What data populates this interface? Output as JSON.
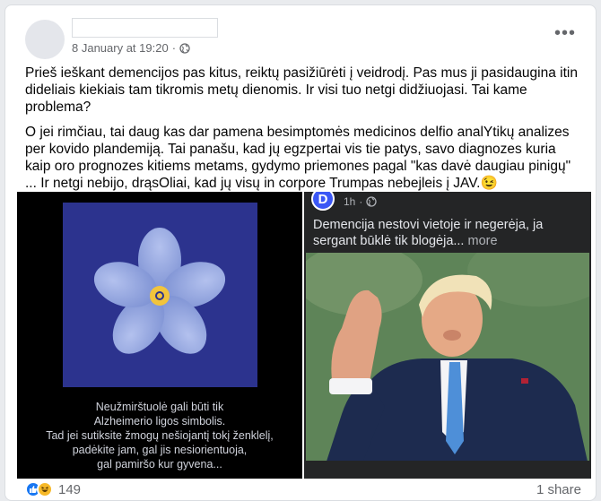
{
  "post": {
    "timestamp": "8 January at 19:20",
    "paragraph1": "Prieš ieškant demencijos pas kitus, reiktų pasižiūrėti į veidrodį. Pas mus ji pasidaugina itin dideliais kiekiais tam tikromis metų dienomis. Ir visi tuo netgi didžiuojasi. Tai kame problema?",
    "paragraph2": "O jei rimčiau, tai daug kas dar pamena besimptomės medicinos delfio analYtikų analizes per kovido plandemiją. Tai panašu, kad jų egzpertai vis tie patys, savo diagnozes kuria kaip oro prognozes kitiems metams, gydymo priemones pagal \"kas davė daugiau pinigų\" ... Ir netgi nebijo, drąsOliai, kad jų visų in corpore Trumpas nebejleis į JAV.😉"
  },
  "left_image": {
    "caption_lines": [
      "Neužmirštuolė gali būti tik",
      "Alzheimerio ligos simbolis.",
      "Tad jei sutiksite žmogų nešiojantį tokį ženklelį,",
      "padėkite jam, gal jis nesiorientuoja,",
      "gal pamiršo kur gyvena..."
    ],
    "panel_color": "#2c338e",
    "petal_color": "#8fa2dc"
  },
  "shared_post": {
    "avatar_letter": "D",
    "time": "1h",
    "text": "Demencija nestovi vietoje ir negerėja, ja sergant būklė tik blogėja...",
    "more_label": "more"
  },
  "footer": {
    "reaction_count": "149",
    "share_label": "1 share"
  },
  "colors": {
    "accent": "#1877f2",
    "haha": "#f7b928",
    "muted_text": "#65676b"
  }
}
